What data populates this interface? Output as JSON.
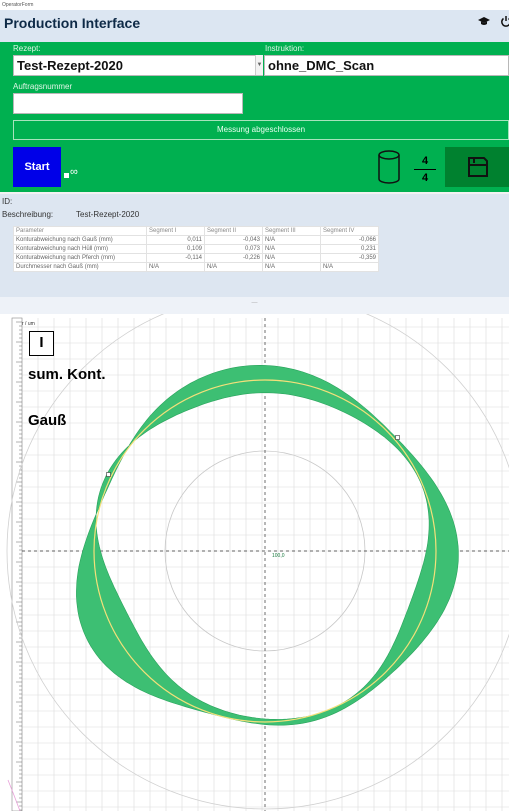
{
  "window": {
    "title": "OperatorForm"
  },
  "header": {
    "title": "Production Interface",
    "hat_icon": "graduation-cap-icon",
    "power_icon": "power-icon"
  },
  "recipe": {
    "label": "Rezept:",
    "value": "Test-Rezept-2020"
  },
  "instruction": {
    "label": "Instruktion:",
    "value": "ohne_DMC_Scan"
  },
  "order": {
    "label": "Auftragsnummer",
    "value": ""
  },
  "status": {
    "measurement": "Messung abgeschlossen"
  },
  "controls": {
    "start_label": "Start",
    "loop_symbol": "∞"
  },
  "counter": {
    "current": "4",
    "total": "4"
  },
  "colors": {
    "green": "#00b050",
    "dark_green": "#00812f",
    "start_blue": "#0000e8",
    "band": "#3dbf73"
  },
  "info": {
    "id_label": "ID:",
    "description_label": "Beschreibung:",
    "description_value": "Test-Rezept-2020"
  },
  "table": {
    "headers": [
      "Parameter",
      "Segment I",
      "Segment II",
      "Segment III",
      "Segment IV"
    ],
    "rows": [
      [
        "Konturabweichung nach Gauß (mm)",
        "0,011",
        "-0,043",
        "N/A",
        "-0,066"
      ],
      [
        "Konturabweichung nach Hüll (mm)",
        "0,109",
        "0,073",
        "N/A",
        "0,231"
      ],
      [
        "Konturabweichung nach Pferch (mm)",
        "-0,114",
        "-0,226",
        "N/A",
        "-0,359"
      ],
      [
        "Durchmesser nach Gauß (mm)",
        "N/A",
        "N/A",
        "N/A",
        "N/A"
      ]
    ]
  },
  "splitter": {
    "label": "—"
  },
  "chart": {
    "top_left_label": "r / um",
    "segment_label": "I",
    "line1": "sum. Kont.",
    "line2": "Gauß",
    "center_value": "100,0"
  },
  "chart_data": {
    "type": "polar-contour",
    "center_label": "100,0",
    "annotations": [
      "I",
      "sum. Kont.",
      "Gauß"
    ],
    "series": [
      {
        "name": "sum. Kont.",
        "type": "band"
      },
      {
        "name": "Gauß",
        "type": "circle"
      }
    ]
  }
}
